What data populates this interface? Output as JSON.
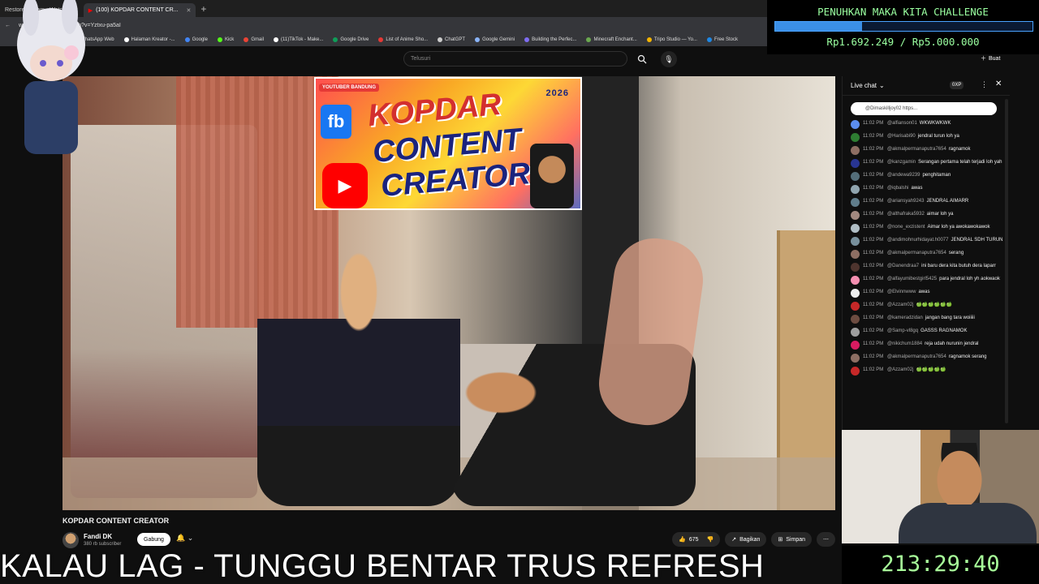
{
  "browser": {
    "tabs": [
      {
        "title": "Restore Stream - Watch",
        "active": false
      },
      {
        "title": "(100) KOPDAR CONTENT CR...",
        "active": true
      }
    ],
    "url": "www.youtube.com/watch?v=Yztxu-pa5aI",
    "bookmarks": [
      {
        "label": "WhatsApp Web",
        "color": "#25d366"
      },
      {
        "label": "Halaman Kreator -...",
        "color": "#ffffff"
      },
      {
        "label": "Google",
        "color": "#4285f4"
      },
      {
        "label": "Kick",
        "color": "#53fc18"
      },
      {
        "label": "Gmail",
        "color": "#ea4335"
      },
      {
        "label": "(11)TikTok - Make...",
        "color": "#ffffff"
      },
      {
        "label": "Google Drive",
        "color": "#0f9d58"
      },
      {
        "label": "List of Anime Sho...",
        "color": "#e53935"
      },
      {
        "label": "ChatGPT",
        "color": "#cccccc"
      },
      {
        "label": "Google Gemini",
        "color": "#8ab4f8"
      },
      {
        "label": "Building the Perfec...",
        "color": "#7f6df2"
      },
      {
        "label": "Minecraft Enchant...",
        "color": "#6aa84f"
      },
      {
        "label": "Tripo Studio — Yo...",
        "color": "#f4b400"
      },
      {
        "label": "Free Stock",
        "color": "#1e88e5"
      }
    ]
  },
  "youtube": {
    "search_placeholder": "Telusuri",
    "create_label": "Buat",
    "video_title": "KOPDAR CONTENT CREATOR",
    "channel_name": "Fandi DK",
    "channel_subs": "380 rb subscriber",
    "join_label": "Gabung",
    "like_count": "675",
    "share_label": "Bagikan",
    "save_label": "Simpan",
    "banner": {
      "tag": "YOUTUBER BANDUNG",
      "year": "2026",
      "line1": "KOPDAR",
      "line2": "CONTENT",
      "line3": "CREATOR",
      "fb": "fb"
    }
  },
  "goal": {
    "title": "PENUHKAN MAKA KITA CHALLENGE",
    "amount": "Rp1.692.249 / Rp5.000.000",
    "progress": 0.338
  },
  "chat": {
    "title": "Live chat",
    "xp": "0XP",
    "pinned": "@Dimaskilljoy02 https...",
    "messages": [
      {
        "time": "11:02 PM",
        "user": "@alfianson01",
        "text": "WKWKWKWK",
        "color": "#5b8def"
      },
      {
        "time": "11:02 PM",
        "user": "@Harisabi90",
        "text": "jendral turun loh ya",
        "color": "#2e7d32"
      },
      {
        "time": "11:02 PM",
        "user": "@akmalpermanaputra7654",
        "text": "ragnamok",
        "color": "#8d6e63"
      },
      {
        "time": "11:02 PM",
        "user": "@kanzgamin",
        "text": "Serangan pertama telah terjadi loh yah",
        "color": "#283593"
      },
      {
        "time": "11:02 PM",
        "user": "@andewa9239",
        "text": "penghitaman",
        "color": "#546e7a"
      },
      {
        "time": "11:02 PM",
        "user": "@iqbalshi",
        "text": "awas",
        "color": "#90a4ae"
      },
      {
        "time": "11:02 PM",
        "user": "@ariansyah9243",
        "text": "JENDRAL AIMARR",
        "color": "#607d8b"
      },
      {
        "time": "11:02 PM",
        "user": "@althafraka5932",
        "text": "aimar loh ya",
        "color": "#a1887f"
      },
      {
        "time": "11:02 PM",
        "user": "@none_exzistent",
        "text": "Aimar loh ya awokawokawok",
        "color": "#b0bec5"
      },
      {
        "time": "11:02 PM",
        "user": "@andimohnurhidayat.h0077",
        "text": "JENDRAL SDH TURUN",
        "color": "#78909c"
      },
      {
        "time": "11:02 PM",
        "user": "@akmalpermanaputra7654",
        "text": "serang",
        "color": "#8d6e63"
      },
      {
        "time": "11:02 PM",
        "user": "@Danendraa7",
        "text": "ini baru dera kita butuh dera laparr",
        "color": "#4e342e"
      },
      {
        "time": "11:02 PM",
        "user": "@alfayumibestgirl5425",
        "text": "para jendral loh yh aokwaok",
        "color": "#f48fb1"
      },
      {
        "time": "11:02 PM",
        "user": "@Elvinnwww",
        "text": "awas",
        "color": "#eeeeee"
      },
      {
        "time": "11:02 PM",
        "user": "@Azzam02j",
        "text": "🍏🍏🍏🍏🍏🍏",
        "color": "#c62828"
      },
      {
        "time": "11:02 PM",
        "user": "@kameradzidan",
        "text": "jangan bang tara woiiiii",
        "color": "#6d4c41"
      },
      {
        "time": "11:02 PM",
        "user": "@Samp-vl8gq",
        "text": "GASSS RAGNAMOK",
        "color": "#9e9e9e"
      },
      {
        "time": "11:02 PM",
        "user": "@nikichum1884",
        "text": "reja udah nurunin jendral",
        "color": "#d81b60"
      },
      {
        "time": "11:02 PM",
        "user": "@akmalpermanaputra7654",
        "text": "ragnamok serang",
        "color": "#8d6e63"
      },
      {
        "time": "11:02 PM",
        "user": "@Azzam02j",
        "text": "🍏🍏🍏🍏🍏",
        "color": "#c62828"
      }
    ]
  },
  "ticker": "KALAU LAG - TUNGGU BENTAR TRUS REFRESH",
  "timer": "213:29:40"
}
